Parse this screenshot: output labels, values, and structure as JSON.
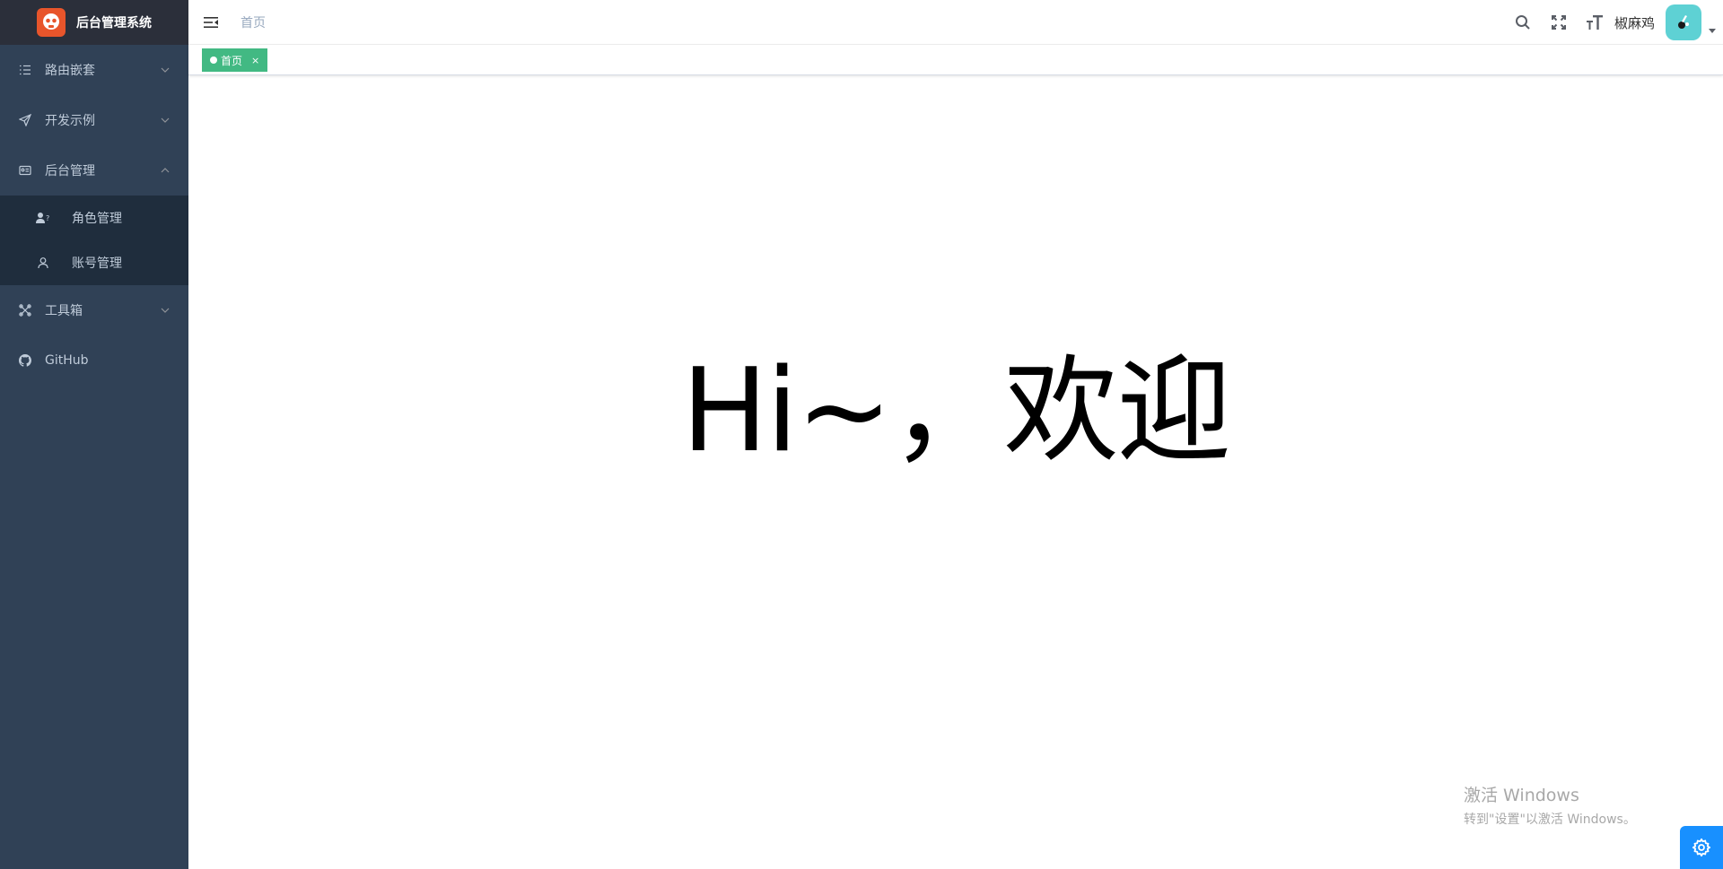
{
  "app": {
    "title": "后台管理系统"
  },
  "sidebar": {
    "items": [
      {
        "label": "路由嵌套",
        "icon": "list-icon",
        "expanded": false
      },
      {
        "label": "开发示例",
        "icon": "paper-plane-icon",
        "expanded": false
      },
      {
        "label": "后台管理",
        "icon": "id-card-icon",
        "expanded": true,
        "children": [
          {
            "label": "角色管理",
            "icon": "user-role-icon"
          },
          {
            "label": "账号管理",
            "icon": "user-icon"
          }
        ]
      },
      {
        "label": "工具箱",
        "icon": "tools-icon",
        "expanded": false
      },
      {
        "label": "GitHub",
        "icon": "github-icon"
      }
    ]
  },
  "header": {
    "breadcrumb": "首页",
    "username": "椒麻鸡"
  },
  "tags": {
    "active": {
      "label": "首页",
      "close": "×"
    }
  },
  "main": {
    "welcome": "Hi~，欢迎"
  },
  "watermark": {
    "title": "激活 Windows",
    "subtitle": "转到\"设置\"以激活 Windows。"
  },
  "colors": {
    "sidebar_bg": "#304156",
    "logo_bar_bg": "#2b2f3a",
    "submenu_bg": "#1f2d3d",
    "sidebar_text": "#bfcbd9",
    "tag_active": "#42b983",
    "settings_button": "#1890ff",
    "avatar_bg": "#5ed1d4"
  }
}
